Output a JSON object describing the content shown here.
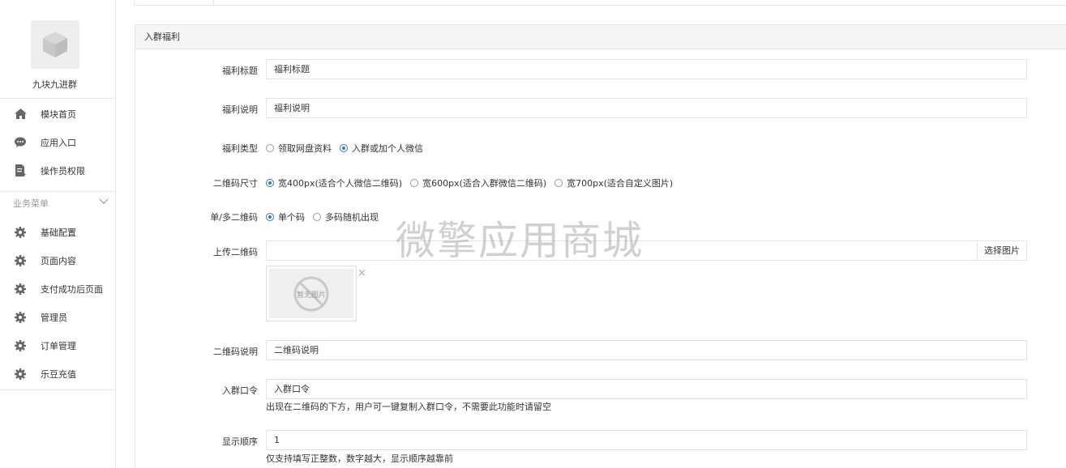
{
  "sidebar": {
    "brand_name": "九块九进群",
    "top_items": [
      {
        "label": "模块首页",
        "icon": "home-icon"
      },
      {
        "label": "应用入口",
        "icon": "chat-icon"
      },
      {
        "label": "操作员权限",
        "icon": "document-icon"
      }
    ],
    "section_label": "业务菜单",
    "menu_items": [
      {
        "label": "基础配置",
        "icon": "gear-icon"
      },
      {
        "label": "页面内容",
        "icon": "gear-icon"
      },
      {
        "label": "支付成功后页面",
        "icon": "gear-icon"
      },
      {
        "label": "管理员",
        "icon": "gear-icon"
      },
      {
        "label": "订单管理",
        "icon": "gear-icon"
      },
      {
        "label": "乐豆充值",
        "icon": "gear-icon"
      }
    ]
  },
  "panel": {
    "title": "入群福利"
  },
  "form": {
    "benefit_title": {
      "label": "福利标题",
      "value": "福利标题"
    },
    "benefit_desc": {
      "label": "福利说明",
      "value": "福利说明"
    },
    "benefit_type": {
      "label": "福利类型",
      "options": [
        "领取网盘资料",
        "入群或加个人微信"
      ],
      "selected": 1
    },
    "qr_size": {
      "label": "二维码尺寸",
      "options": [
        "宽400px(适合个人微信二维码)",
        "宽600px(适合入群微信二维码)",
        "宽700px(适合自定义图片)"
      ],
      "selected": 0
    },
    "qr_mode": {
      "label": "单/多二维码",
      "options": [
        "单个码",
        "多码随机出现"
      ],
      "selected": 0
    },
    "upload_qr": {
      "label": "上传二维码",
      "value": "",
      "button": "选择图片",
      "placeholder_image_text": "暂无图片"
    },
    "qr_desc": {
      "label": "二维码说明",
      "value": "二维码说明"
    },
    "group_code": {
      "label": "入群口令",
      "value": "入群口令",
      "help": "出现在二维码的下方，用户可一键复制入群口令，不需要此功能时请留空"
    },
    "display_order": {
      "label": "显示顺序",
      "value": "1",
      "help": "仅支持填写正整数，数字越大，显示顺序越靠前"
    }
  },
  "watermark": "微擎应用商城",
  "colors": {
    "accent": "#337ab7",
    "border": "#e6e6e6",
    "panel_head": "#f5f5f5",
    "icon": "#666666"
  }
}
